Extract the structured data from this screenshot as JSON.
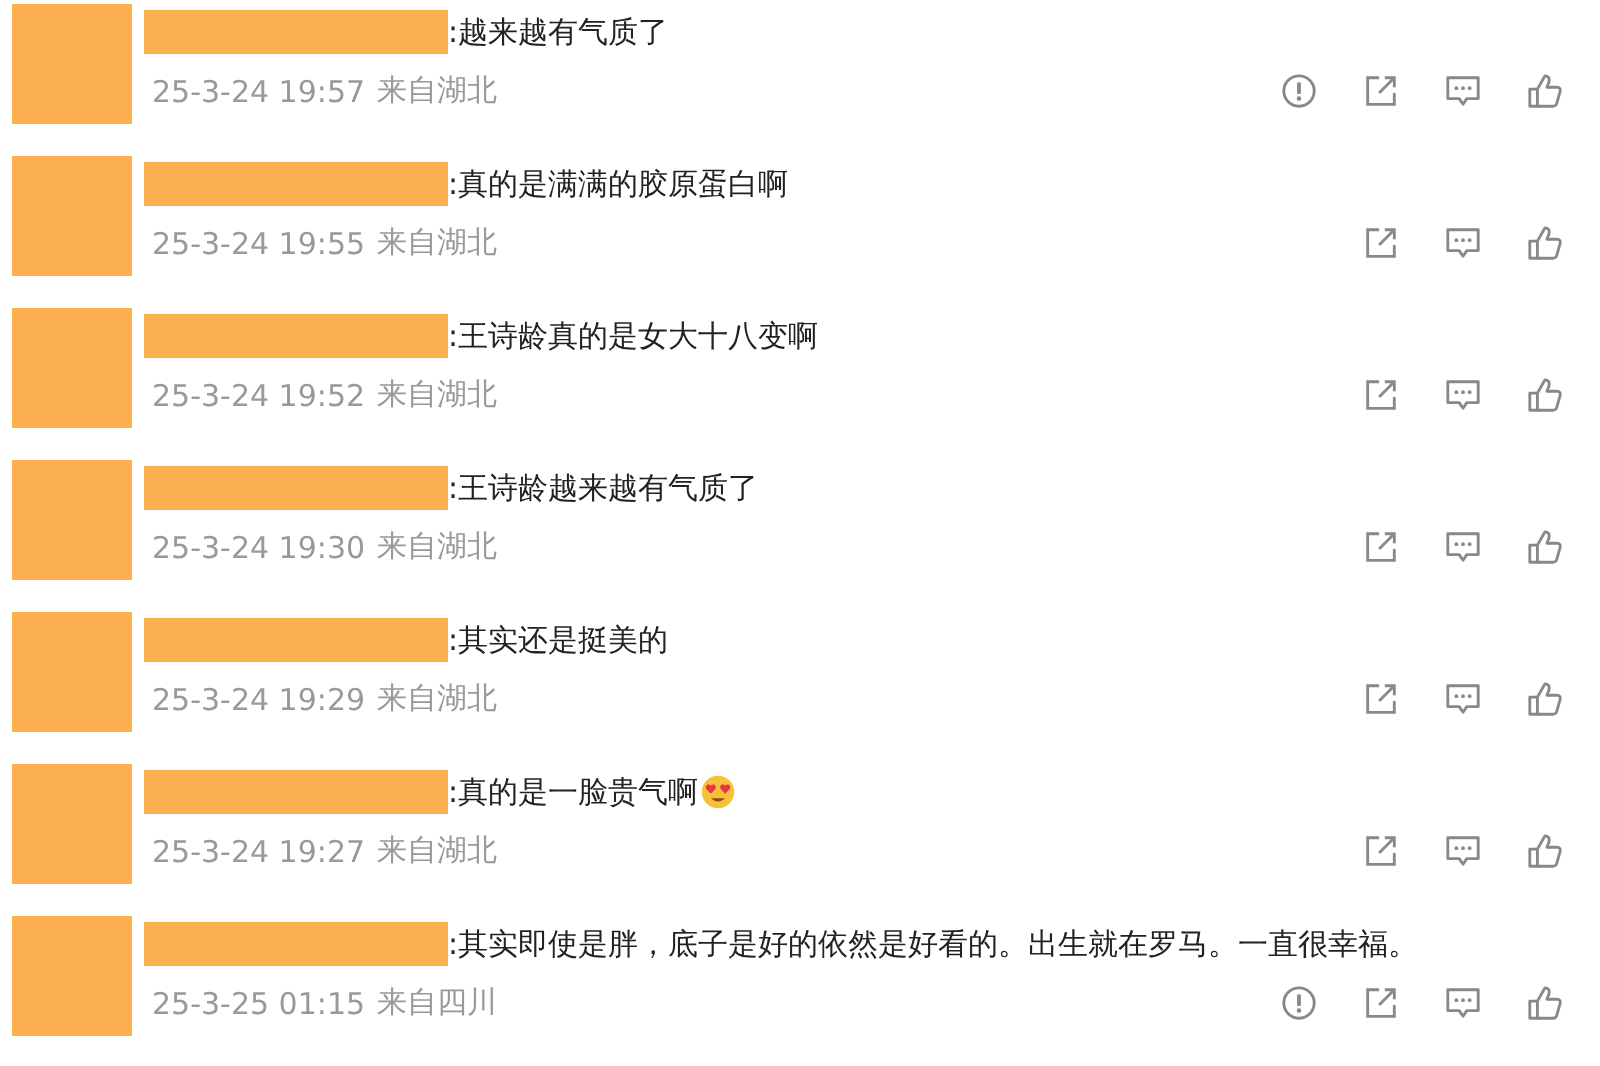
{
  "comments": [
    {
      "text": ":越来越有气质了",
      "time": "25-3-24 19:57",
      "location": "来自湖北",
      "reportable": true,
      "emoji": false
    },
    {
      "text": ":真的是满满的胶原蛋白啊",
      "time": "25-3-24 19:55",
      "location": "来自湖北",
      "reportable": false,
      "emoji": false
    },
    {
      "text": ":王诗龄真的是女大十八变啊",
      "time": "25-3-24 19:52",
      "location": "来自湖北",
      "reportable": false,
      "emoji": false
    },
    {
      "text": ":王诗龄越来越有气质了",
      "time": "25-3-24 19:30",
      "location": "来自湖北",
      "reportable": false,
      "emoji": false
    },
    {
      "text": ":其实还是挺美的",
      "time": "25-3-24 19:29",
      "location": "来自湖北",
      "reportable": false,
      "emoji": false
    },
    {
      "text": ":真的是一脸贵气啊",
      "time": "25-3-24 19:27",
      "location": "来自湖北",
      "reportable": false,
      "emoji": true
    },
    {
      "text": ":其实即使是胖，底子是好的依然是好看的。出生就在罗马。一直很幸福。",
      "time": "25-3-25 01:15",
      "location": "来自四川",
      "reportable": true,
      "emoji": false
    }
  ]
}
